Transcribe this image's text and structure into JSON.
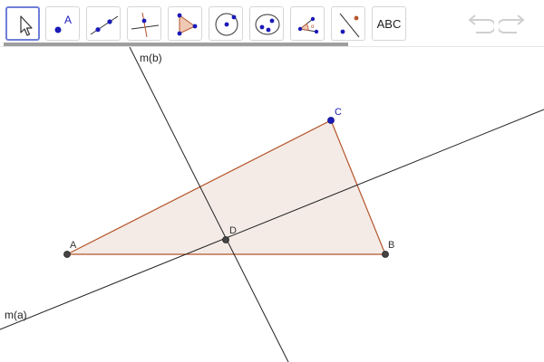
{
  "toolbar": {
    "tools": [
      {
        "name": "move-tool",
        "icon": "pointer-arrow-icon",
        "selected": true
      },
      {
        "name": "point-tool",
        "icon": "point-icon",
        "label": "A"
      },
      {
        "name": "line-tool",
        "icon": "line-through-points-icon"
      },
      {
        "name": "perpendicular-line-tool",
        "icon": "perpendicular-line-icon"
      },
      {
        "name": "polygon-tool",
        "icon": "polygon-icon"
      },
      {
        "name": "circle-center-point-tool",
        "icon": "circle-center-point-icon"
      },
      {
        "name": "conic-tool",
        "icon": "ellipse-icon"
      },
      {
        "name": "angle-tool",
        "icon": "angle-icon"
      },
      {
        "name": "reflect-tool",
        "icon": "reflect-about-line-icon"
      },
      {
        "name": "text-tool",
        "icon": "text-icon",
        "label": "ABC"
      }
    ],
    "undo_icon": "undo-icon",
    "redo_icon": "redo-icon"
  },
  "colors": {
    "selected_border": "#6f7fd8",
    "polygon_fill": "#f4ebe6",
    "polygon_stroke": "#b5552b",
    "point_blue": "#1a1ab8",
    "point_dark": "#444444",
    "line": "#222222"
  },
  "graphics": {
    "points": {
      "A": "A",
      "B": "B",
      "C": "C",
      "D": "D"
    },
    "lines": {
      "m_a": "m(a)",
      "m_b": "m(b)"
    }
  }
}
